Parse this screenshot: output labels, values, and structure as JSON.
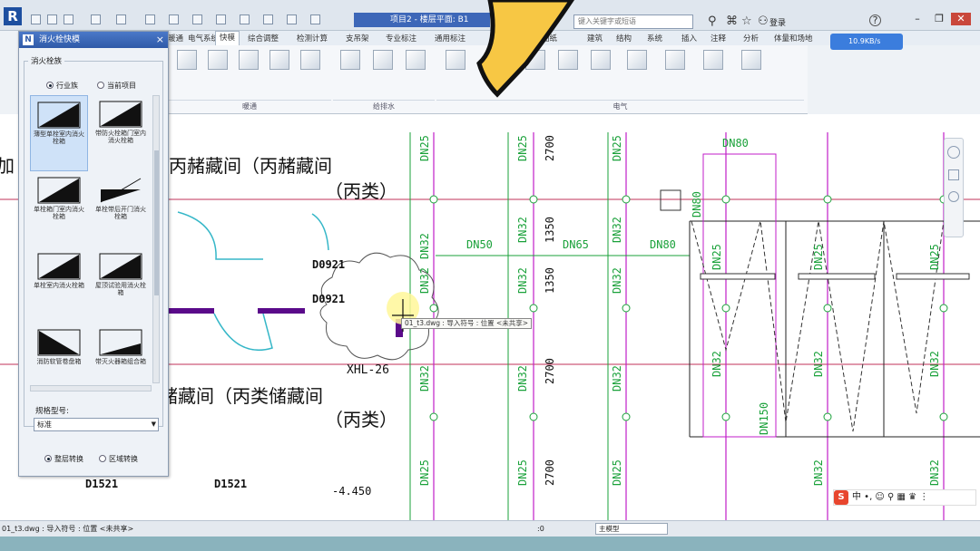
{
  "window": {
    "doc_title": "项目2 - 楼层平面: B1",
    "search_placeholder": "键入关键字或短语",
    "login": "登录",
    "help": "?"
  },
  "ribbon": {
    "tabs": [
      "暖通",
      "电气系统",
      "快模",
      "综合调整",
      "检测计算",
      "支吊架",
      "专业标注",
      "通用标注",
      "图纸",
      "建筑",
      "结构",
      "系统",
      "插入",
      "注释",
      "分析",
      "体量和场地"
    ],
    "active_tab": "快模",
    "groups": [
      "暖通",
      "给排水",
      "电气"
    ],
    "cloud_label": "10.9KB/s"
  },
  "palette": {
    "title": "消火栓快模",
    "group_label": "消火栓族",
    "radio_industry": "行业族",
    "radio_project": "当前项目",
    "tiles": [
      "薄型单栓室内消火栓箱",
      "带防火栓箱门室内消火栓箱",
      "单栓箱门室内消火栓箱",
      "单栓带后开门消火栓箱",
      "单栓室内消火栓箱",
      "屋顶试验用消火栓箱",
      "消防软管卷盘箱",
      "带灭火器箱组合箱"
    ],
    "spec_label": "规格型号:",
    "spec_value": "标准",
    "radio_floor": "整层转换",
    "radio_area": "区域转换"
  },
  "drawing": {
    "room_a": "丙赭藏间（丙赭藏间",
    "room_a2": "（丙类）",
    "room_b": "赭藏间（丙类储藏间",
    "room_b2": "（丙类）",
    "room_left": "加",
    "door1": "D0921",
    "door2": "D0921",
    "door3": "D1521",
    "door4": "D1521",
    "hydrant_tag": "XHL-26",
    "elevation": "-4.450",
    "pipes": {
      "dn25": "DN25",
      "dn32": "DN32",
      "dn50": "DN50",
      "dn65": "DN65",
      "dn80": "DN80",
      "dn150": "DN150"
    },
    "dims": {
      "d2700": "2700",
      "d1350": "1350"
    },
    "tooltip": "01_t3.dwg : 导入符号 : 位置 <未共享>"
  },
  "statusbar": {
    "text": "01_t3.dwg : 导入符号 : 位置 <未共享>",
    "zero": ":0",
    "view": "主模型"
  },
  "ime": {
    "label": "中"
  },
  "colors": {
    "pipe_green": "#1aa13a",
    "grid_magenta": "#c01ec8",
    "wall_purple": "#5a0a8a",
    "door_cyan": "#36b7c8",
    "ribbon_blue": "#3d67b8",
    "arrow_yellow": "#f7c744"
  }
}
